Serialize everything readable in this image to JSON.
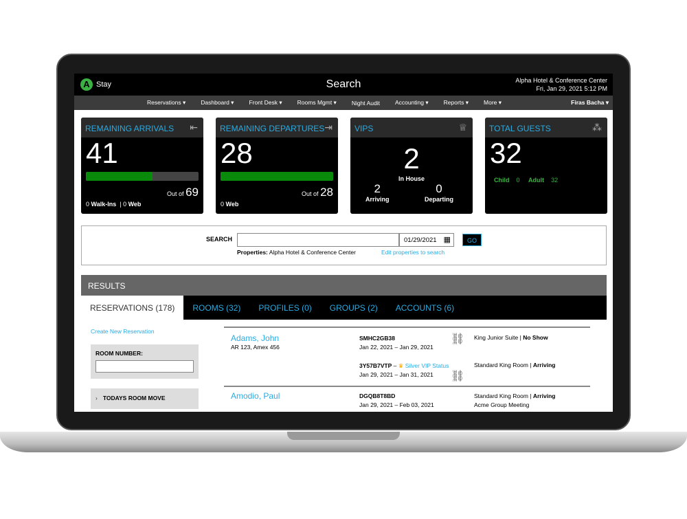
{
  "app": {
    "logo_letter": "A",
    "name": "Stay",
    "page_title": "Search",
    "hotel": "Alpha Hotel & Conference Center",
    "datetime": "Fri, Jan 29, 2021 5:12 PM"
  },
  "nav": [
    "Reservations ▾",
    "Dashboard ▾",
    "Front Desk ▾",
    "Rooms Mgmt ▾",
    "Night Audit",
    "Accounting ▾",
    "Reports ▾",
    "More ▾"
  ],
  "user": "Firas Bacha ▾",
  "cards": {
    "arrivals": {
      "title": "REMAINING ARRIVALS",
      "value": "41",
      "out_of_label": "Out of",
      "total": "69",
      "progress": 0.59,
      "walkins": "0",
      "walkins_label": "Walk-Ins",
      "web": "0",
      "web_label": "Web"
    },
    "departures": {
      "title": "REMAINING DEPARTURES",
      "value": "28",
      "out_of_label": "Out of",
      "total": "28",
      "progress": 1.0,
      "web": "0",
      "web_label": "Web"
    },
    "vips": {
      "title": "VIPS",
      "in_house": "2",
      "in_house_label": "In House",
      "arriving": "2",
      "arriving_label": "Arriving",
      "departing": "0",
      "departing_label": "Departing"
    },
    "guests": {
      "title": "TOTAL GUESTS",
      "value": "32",
      "child_label": "Child",
      "child": "0",
      "adult_label": "Adult",
      "adult": "32"
    }
  },
  "search": {
    "label": "SEARCH",
    "value": "",
    "date": "01/29/2021",
    "go": "GO",
    "properties_label": "Properties:",
    "properties": "Alpha Hotel & Conference Center",
    "edit_link": "Edit properties to search"
  },
  "results": {
    "header": "RESULTS",
    "tabs": [
      "RESERVATIONS (178)",
      "ROOMS (32)",
      "PROFILES (0)",
      "GROUPS (2)",
      "ACCOUNTS (6)"
    ],
    "create_link": "Create New Reservation",
    "room_number_label": "ROOM NUMBER:",
    "room_number_value": "",
    "room_move": "TODAYS ROOM MOVE",
    "rows": [
      {
        "name": "Adams, John",
        "sub": "AR 123, Amex 456",
        "res": [
          {
            "code": "SMHC2GB38",
            "vip": "",
            "dates": "Jan 22, 2021 – Jan 29, 2021",
            "room": "King Junior Suite",
            "status": "No Show",
            "extra": ""
          },
          {
            "code": "3Y57B7VTP",
            "vip": "Silver VIP Status",
            "dates": "Jan 29, 2021 – Jan 31, 2021",
            "room": "Standard King Room",
            "status": "Arriving",
            "extra": ""
          }
        ]
      },
      {
        "name": "Amodio, Paul",
        "sub": "",
        "res": [
          {
            "code": "DGQB8T8BD",
            "vip": "",
            "dates": "Jan 29, 2021 – Feb 03, 2021",
            "room": "Standard King Room",
            "status": "Arriving",
            "extra": "Acme Group Meeting"
          }
        ]
      }
    ]
  }
}
